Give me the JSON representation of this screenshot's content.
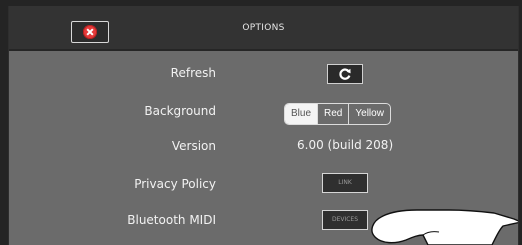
{
  "header": {
    "title": "OPTIONS",
    "close_icon": "close-icon"
  },
  "rows": {
    "refresh": {
      "label": "Refresh",
      "icon": "refresh-icon"
    },
    "background": {
      "label": "Background",
      "options": [
        "Blue",
        "Red",
        "Yellow"
      ],
      "selected": "Blue"
    },
    "version": {
      "label": "Version",
      "value": "6.00 (build 208)"
    },
    "privacy": {
      "label": "Privacy Policy",
      "button": "LINK"
    },
    "bluetooth": {
      "label": "Bluetooth MIDI",
      "button": "DEVICES"
    }
  },
  "overlay": {
    "icon": "pointing-hand-icon"
  },
  "colors": {
    "panel": "#6b6b6b",
    "titlebar": "#333333",
    "close": "#e53a3a"
  }
}
